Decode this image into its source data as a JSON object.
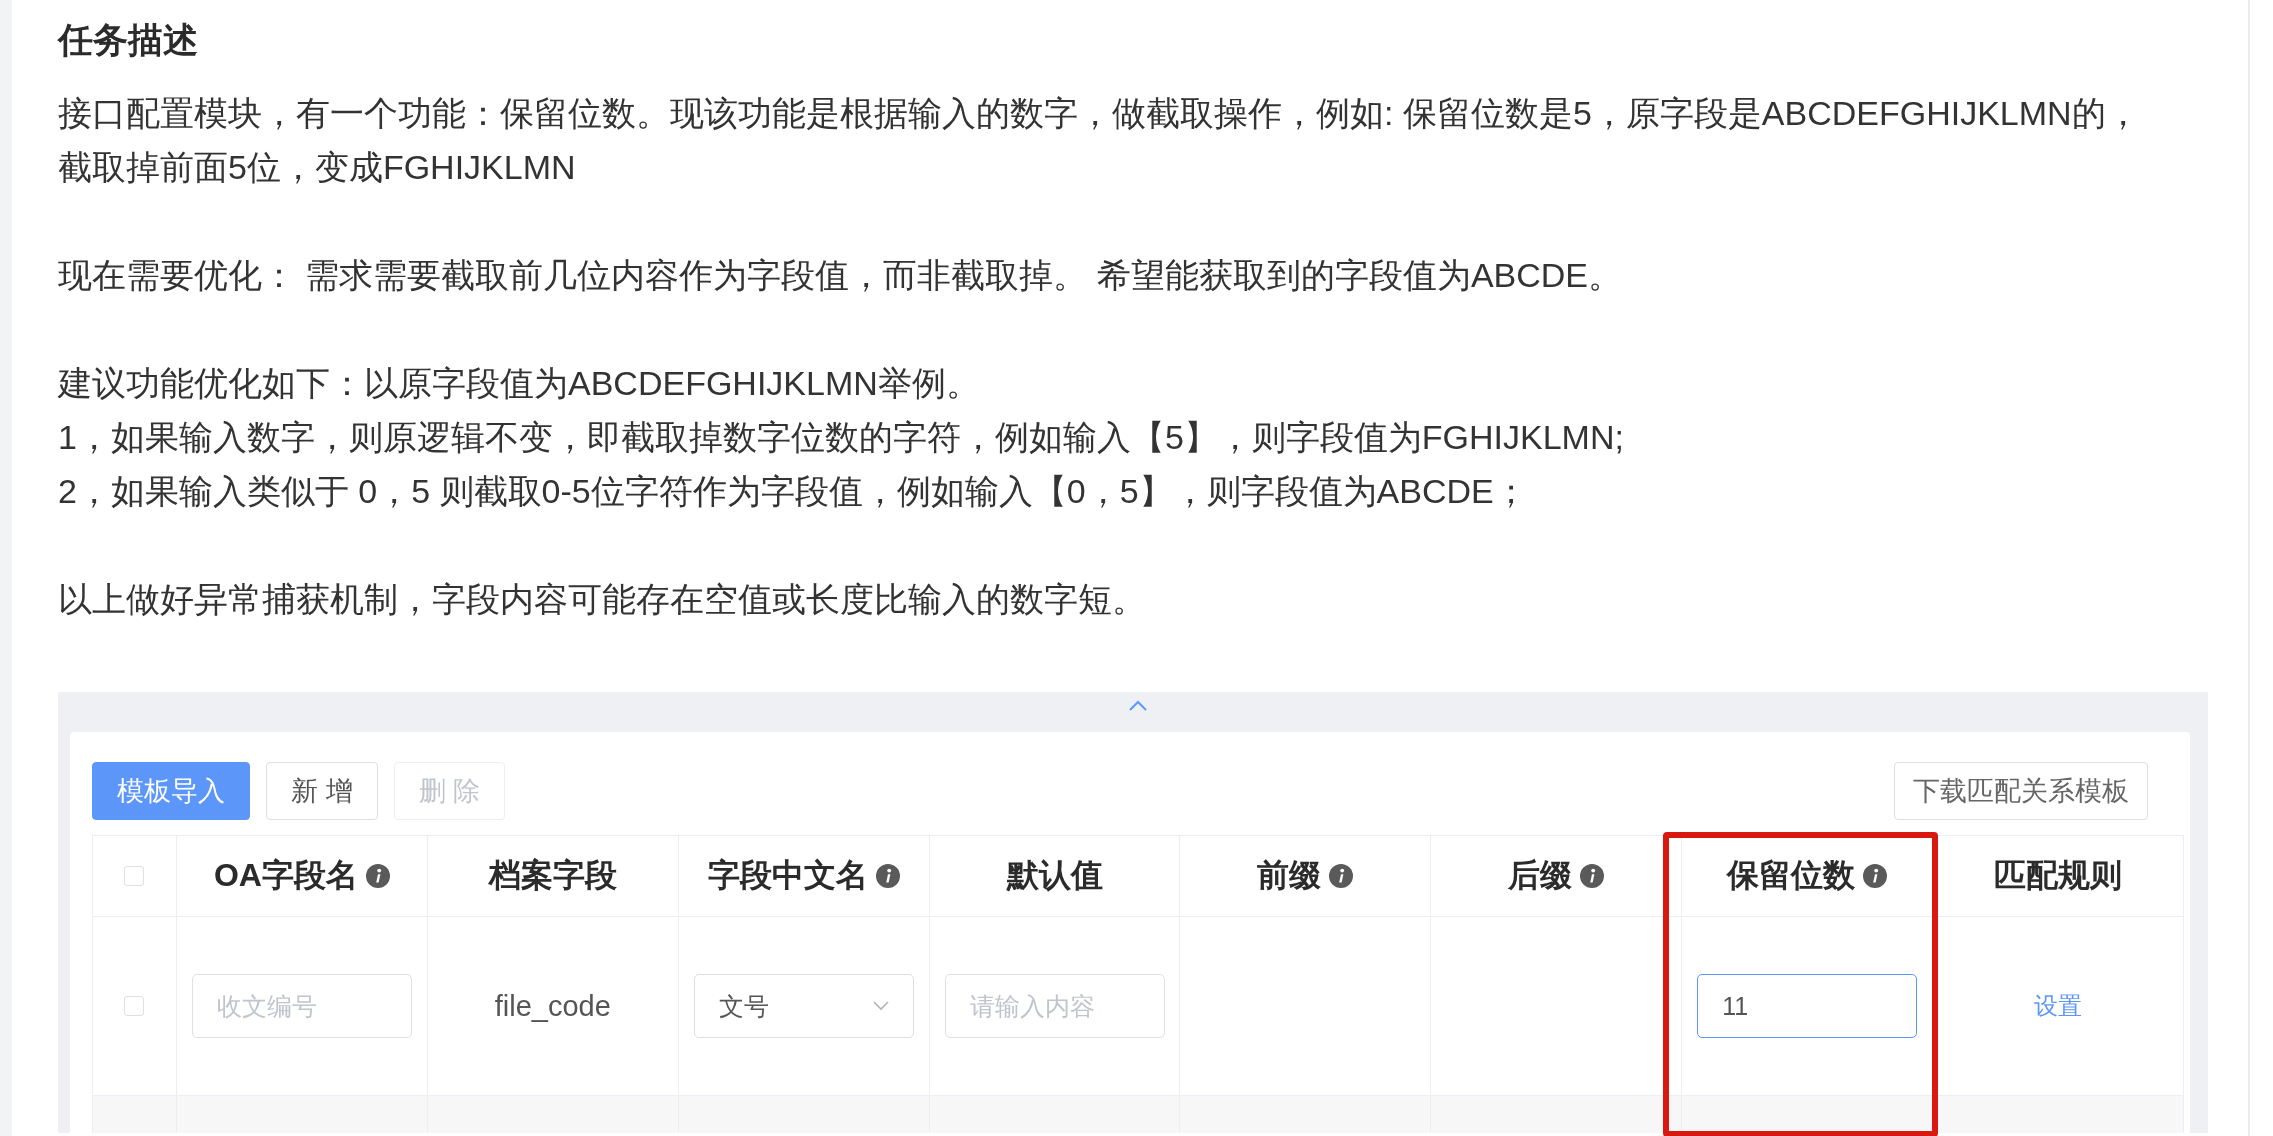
{
  "task": {
    "title": "任务描述",
    "paragraphs": [
      {
        "lines": [
          "接口配置模块，有一个功能：保留位数。现该功能是根据输入的数字，做截取操作，例如: 保留位数是5，原字段是ABCDEFGHIJKLMN的，",
          "截取掉前面5位，变成FGHIJKLMN"
        ]
      },
      {
        "lines": [
          "现在需要优化： 需求需要截取前几位内容作为字段值，而非截取掉。  希望能获取到的字段值为ABCDE。"
        ]
      },
      {
        "lines": [
          "建议功能优化如下：以原字段值为ABCDEFGHIJKLMN举例。",
          "1，如果输入数字，则原逻辑不变，即截取掉数字位数的字符，例如输入【5】，则字段值为FGHIJKLMN;",
          "2，如果输入类似于 0，5 则截取0-5位字符作为字段值，例如输入【0，5】，则字段值为ABCDE；"
        ]
      },
      {
        "lines": [
          "以上做好异常捕获机制，字段内容可能存在空值或长度比输入的数字短。"
        ]
      }
    ]
  },
  "screenshot": {
    "toolbar": {
      "buttons": [
        {
          "label": "模板导入",
          "kind": "primary",
          "disabled": false
        },
        {
          "label": "新 增",
          "kind": "default",
          "disabled": false
        },
        {
          "label": "删 除",
          "kind": "default",
          "disabled": true
        }
      ],
      "download_button": "下载匹配关系模板"
    },
    "table": {
      "select_all": {
        "checked": false
      },
      "columns": [
        {
          "label": "OA字段名",
          "info": true
        },
        {
          "label": "档案字段",
          "info": false
        },
        {
          "label": "字段中文名",
          "info": true
        },
        {
          "label": "默认值",
          "info": false
        },
        {
          "label": "前缀",
          "info": true
        },
        {
          "label": "后缀",
          "info": true
        },
        {
          "label": "保留位数",
          "info": true
        },
        {
          "label": "匹配规则",
          "info": false
        }
      ],
      "rows": [
        {
          "checked": false,
          "cells": [
            {
              "kind": "input",
              "placeholder": "收文编号",
              "focused": false
            },
            {
              "kind": "text",
              "text": "file_code"
            },
            {
              "kind": "select",
              "value": "文号"
            },
            {
              "kind": "input",
              "placeholder": "请输入内容",
              "focused": false
            },
            {
              "kind": "empty"
            },
            {
              "kind": "empty"
            },
            {
              "kind": "input",
              "value": "11",
              "focused": true
            },
            {
              "kind": "link",
              "text": "设置"
            }
          ]
        }
      ]
    },
    "highlight": {
      "kind": "rectangle"
    }
  }
}
